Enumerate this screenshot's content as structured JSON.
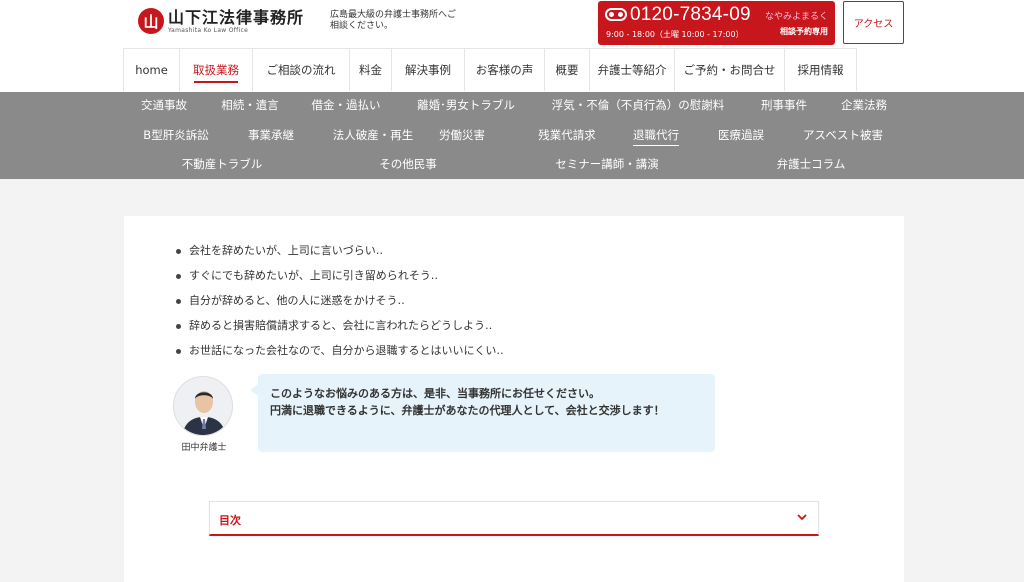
{
  "header": {
    "logo_mark": "山",
    "logo_name": "山下江法律事務所",
    "logo_sub": "Yamashita Ko Law Office",
    "tagline": "広島最大級の弁護士事務所へご相談ください。",
    "phone": {
      "number": "0120-7834-09",
      "hours": "9:00 - 18:00（土曜 10:00 - 17:00）",
      "slogan": "なやみよまるく",
      "note": "相談予約専用"
    },
    "access_label": "アクセス"
  },
  "nav": {
    "items": [
      {
        "label": "home",
        "active": false
      },
      {
        "label": "取扱業務",
        "active": true
      },
      {
        "label": "ご相談の流れ",
        "active": false
      },
      {
        "label": "料金",
        "active": false
      },
      {
        "label": "解決事例",
        "active": false
      },
      {
        "label": "お客様の声",
        "active": false
      },
      {
        "label": "概要",
        "active": false
      },
      {
        "label": "弁護士等紹介",
        "active": false
      },
      {
        "label": "ご予約・お問合せ",
        "active": false
      },
      {
        "label": "採用情報",
        "active": false
      }
    ]
  },
  "subnav": {
    "rows": [
      [
        {
          "label": "交通事故",
          "active": false
        },
        {
          "label": "相続・遺言",
          "active": false
        },
        {
          "label": "借金・過払い",
          "active": false
        },
        {
          "label": "離婚･男女トラブル",
          "active": false
        },
        {
          "label": "浮気・不倫（不貞行為）の慰謝料",
          "active": false
        },
        {
          "label": "刑事事件",
          "active": false
        },
        {
          "label": "企業法務",
          "active": false
        }
      ],
      [
        {
          "label": "B型肝炎訴訟",
          "active": false
        },
        {
          "label": "事業承継",
          "active": false
        },
        {
          "label": "法人破産・再生",
          "active": false
        },
        {
          "label": "労働災害",
          "active": false
        },
        {
          "label": "残業代請求",
          "active": false
        },
        {
          "label": "退職代行",
          "active": true
        },
        {
          "label": "医療過誤",
          "active": false
        },
        {
          "label": "アスベスト被害",
          "active": false
        }
      ],
      [
        {
          "label": "不動産トラブル",
          "active": false
        },
        {
          "label": "その他民事",
          "active": false
        },
        {
          "label": "セミナー講師・講演",
          "active": false
        },
        {
          "label": "弁護士コラム",
          "active": false
        }
      ]
    ]
  },
  "content": {
    "bullets": [
      "会社を辞めたいが、上司に言いづらい‥",
      "すぐにでも辞めたいが、上司に引き留められそう‥",
      "自分が辞めると、他の人に迷惑をかけそう‥",
      "辞めると損害賠償請求すると、会社に言われたらどうしよう‥",
      "お世話になった会社なので、自分から退職するとはいいにくい‥"
    ],
    "lawyer_label": "田中弁護士",
    "bubble_line1": "このようなお悩みのある方は、是非、当事務所にお任せください。",
    "bubble_line2": "円満に退職できるように、弁護士があなたの代理人として、会社と交渉します！",
    "toc_label": "目次"
  },
  "colors": {
    "brand_red": "#c8161d",
    "subnav_gray": "#8a8a8a",
    "bubble_blue": "#e6f3fb"
  }
}
